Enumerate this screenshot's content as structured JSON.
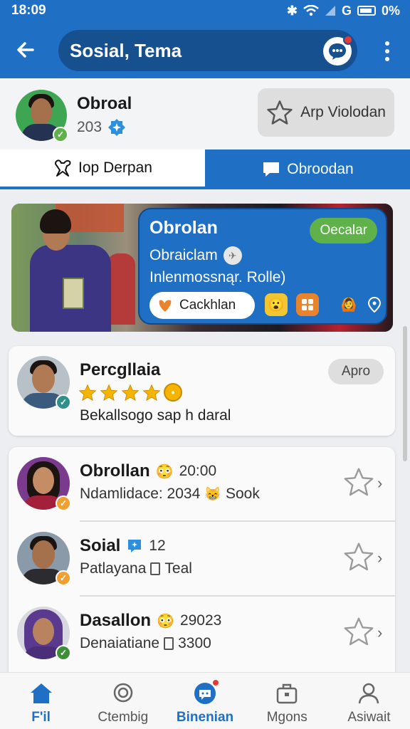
{
  "status_bar": {
    "time": "18:09",
    "network": "G",
    "battery": "0%"
  },
  "app_bar": {
    "title": "Sosial, Tema"
  },
  "profile": {
    "name": "Obroal",
    "count": "203",
    "follow_label": "Arp Violodan"
  },
  "tabs": [
    {
      "label": "Iop Derpan",
      "active": false
    },
    {
      "label": "Obroodan",
      "active": true
    }
  ],
  "featured": {
    "title": "Obrolan",
    "subtitle": "Obraiclam",
    "description": "Inlenmossnąr. Rolle)",
    "badge": "Oecalar",
    "action_label": "Cackhlan"
  },
  "review": {
    "name": "Percgllaia",
    "rating": 4,
    "text": "Bekallsogo sap h daral",
    "button": "Apro"
  },
  "list": [
    {
      "name": "Obrollan",
      "meta": "20:00",
      "sub_a": "Ndamlidace: 2034",
      "sub_b": "Sook",
      "avatar_bg": "#c9a16b",
      "check_color": "#f0a030"
    },
    {
      "name": "Soial",
      "meta": "12",
      "sub_a": "Patlayana",
      "sub_b": "Teal",
      "avatar_bg": "#8a9aa8",
      "check_color": "#f0a030"
    },
    {
      "name": "Dasallon",
      "meta": "29023",
      "sub_a": "Denaiatiane",
      "sub_b": "3300",
      "avatar_bg": "#6b4aa0",
      "check_color": "#3f8f3a"
    }
  ],
  "bottom_nav": [
    {
      "label": "F'il",
      "icon": "home-icon",
      "active": false
    },
    {
      "label": "Ctembig",
      "icon": "search-icon",
      "active": false
    },
    {
      "label": "Binenian",
      "icon": "chat-icon",
      "active": true
    },
    {
      "label": "Mgons",
      "icon": "briefcase-icon",
      "active": false
    },
    {
      "label": "Asiwait",
      "icon": "person-icon",
      "active": false
    }
  ],
  "colors": {
    "primary": "#1f6fc5",
    "dark_primary": "#17508f",
    "green": "#5fb14a",
    "star": "#f4b400"
  }
}
